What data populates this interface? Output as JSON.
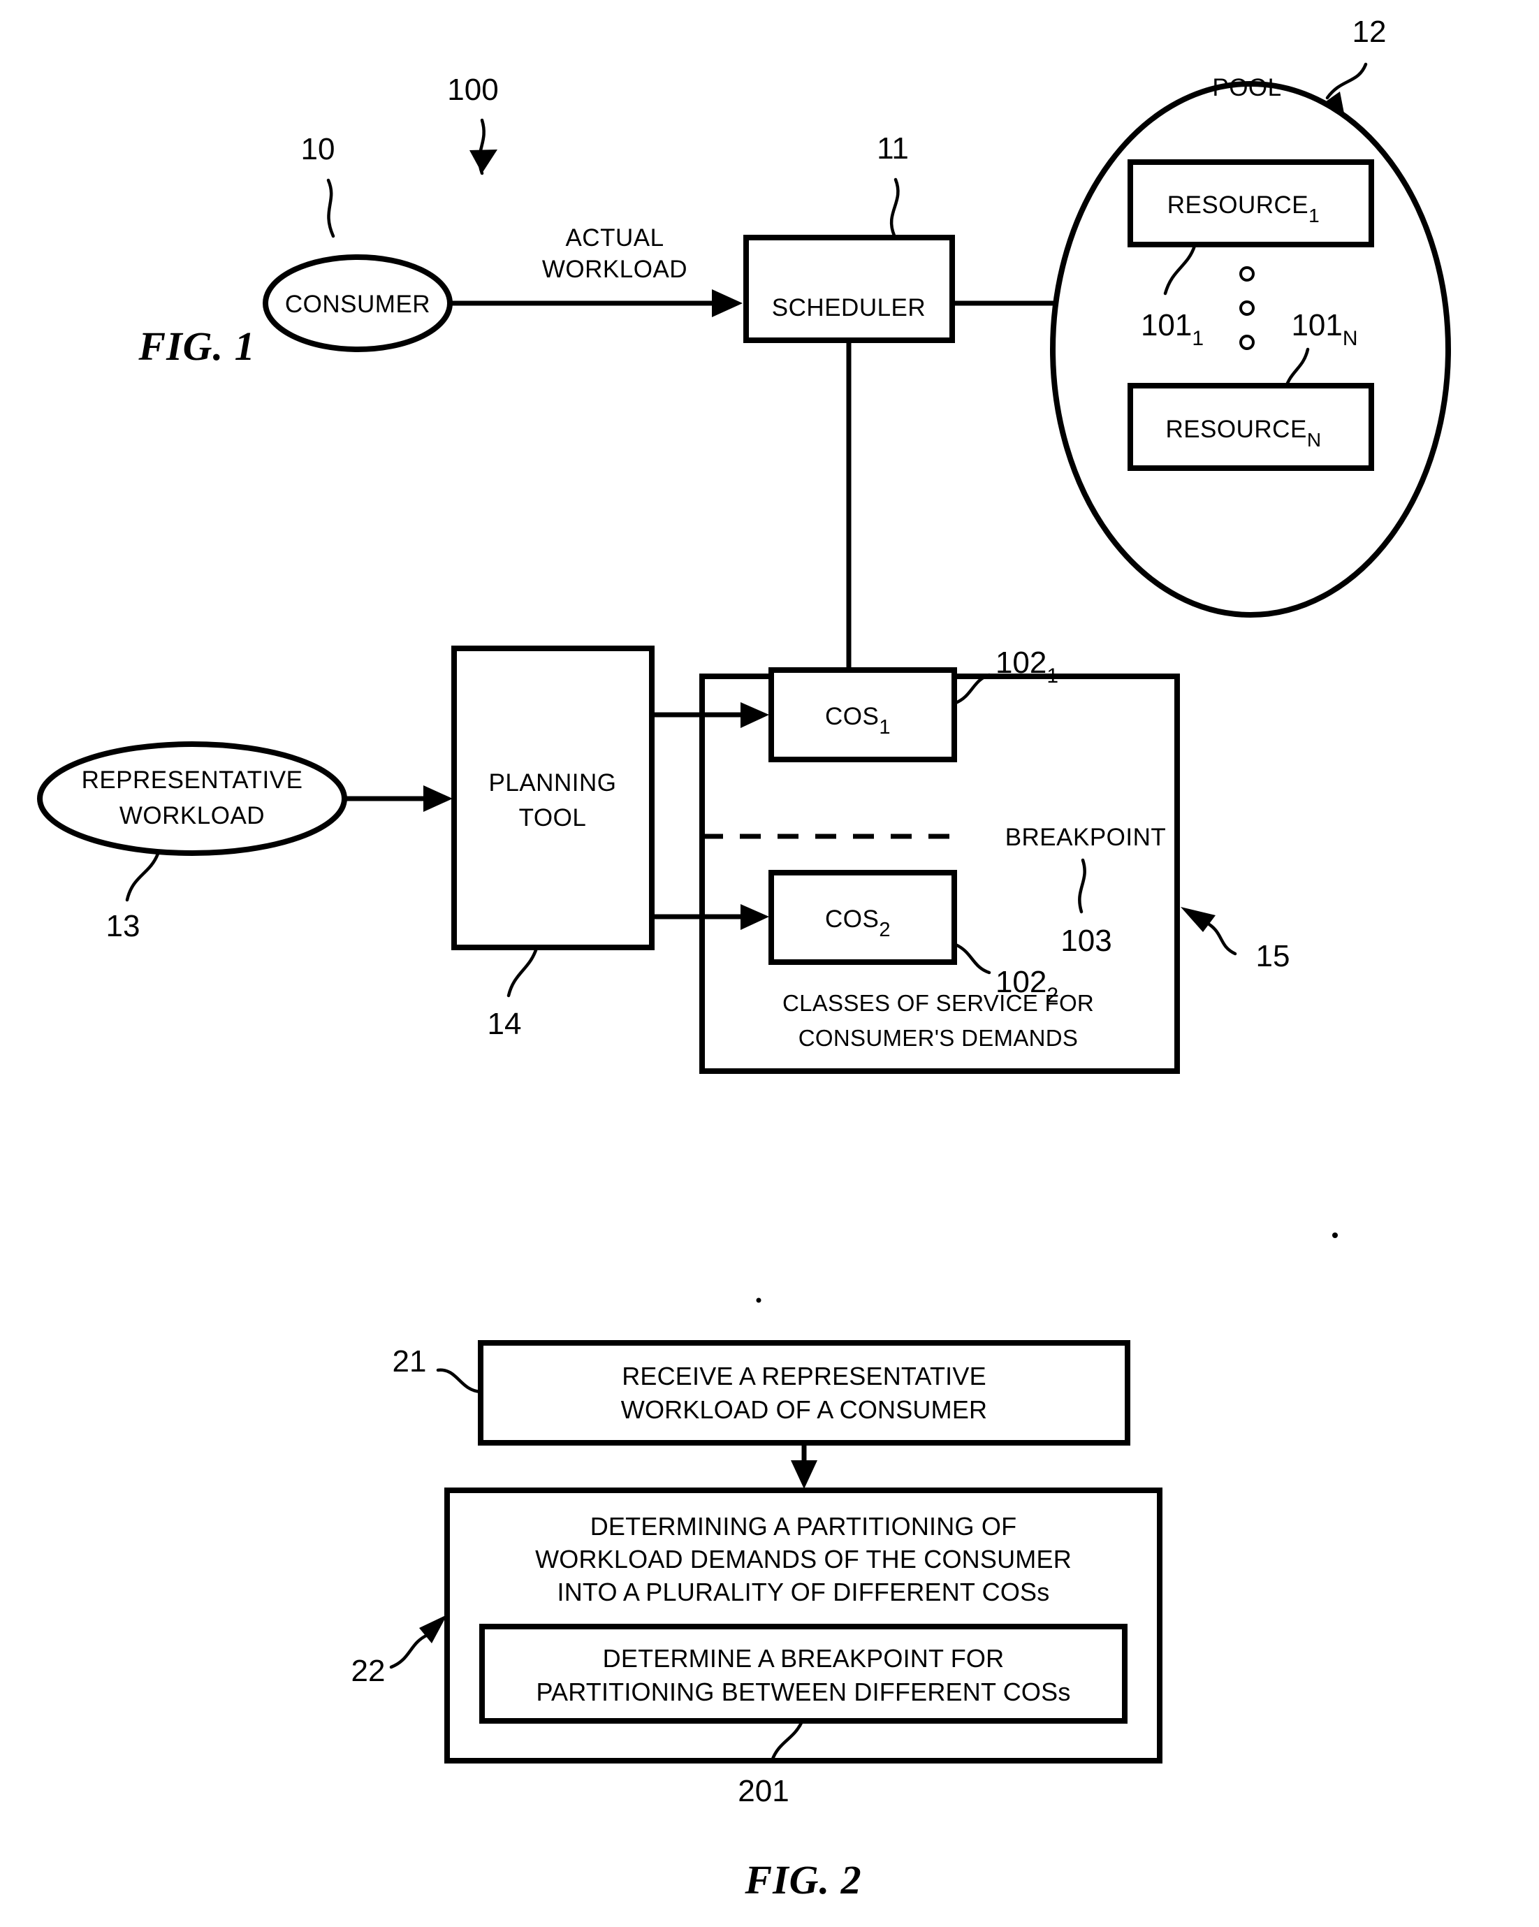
{
  "figures": [
    {
      "id": "fig1",
      "caption": "FIG. 1",
      "system_ref": "100",
      "nodes": {
        "consumer": {
          "label": "CONSUMER",
          "ref": "10"
        },
        "scheduler": {
          "label": "SCHEDULER",
          "ref": "11"
        },
        "pool": {
          "label": "POOL",
          "ref": "12"
        },
        "resource_1": {
          "label": "RESOURCE",
          "subscript": "1",
          "ref": "101",
          "ref_subscript": "1"
        },
        "resource_n": {
          "label": "RESOURCE",
          "subscript": "N",
          "ref": "101",
          "ref_subscript": "N"
        },
        "representative_workload": {
          "label_line1": "REPRESENTATIVE",
          "label_line2": "WORKLOAD",
          "ref": "13"
        },
        "planning_tool": {
          "label_line1": "PLANNING",
          "label_line2": "TOOL",
          "ref": "14"
        },
        "cos_1": {
          "label": "COS",
          "subscript": "1",
          "ref": "102",
          "ref_subscript": "1"
        },
        "cos_2": {
          "label": "COS",
          "subscript": "2",
          "ref": "102",
          "ref_subscript": "2"
        },
        "cos_container": {
          "label_line1": "CLASSES OF SERVICE FOR",
          "label_line2": "CONSUMER'S DEMANDS",
          "ref": "15"
        },
        "breakpoint": {
          "label": "BREAKPOINT",
          "ref": "103"
        }
      },
      "edges": {
        "actual_workload": {
          "label_line1": "ACTUAL",
          "label_line2": "WORKLOAD"
        }
      }
    },
    {
      "id": "fig2",
      "caption": "FIG. 2",
      "steps": [
        {
          "ref": "21",
          "lines": [
            "RECEIVE A REPRESENTATIVE",
            "WORKLOAD OF A CONSUMER"
          ]
        },
        {
          "ref": "22",
          "lines": [
            "DETERMINING A PARTITIONING OF",
            "WORKLOAD DEMANDS OF THE CONSUMER",
            "INTO A PLURALITY OF DIFFERENT COSs"
          ],
          "substep": {
            "ref": "201",
            "lines": [
              "DETERMINE A BREAKPOINT FOR",
              "PARTITIONING BETWEEN DIFFERENT COSs"
            ]
          }
        }
      ]
    }
  ],
  "colors": {
    "ink": "#000000",
    "paper": "#ffffff"
  }
}
